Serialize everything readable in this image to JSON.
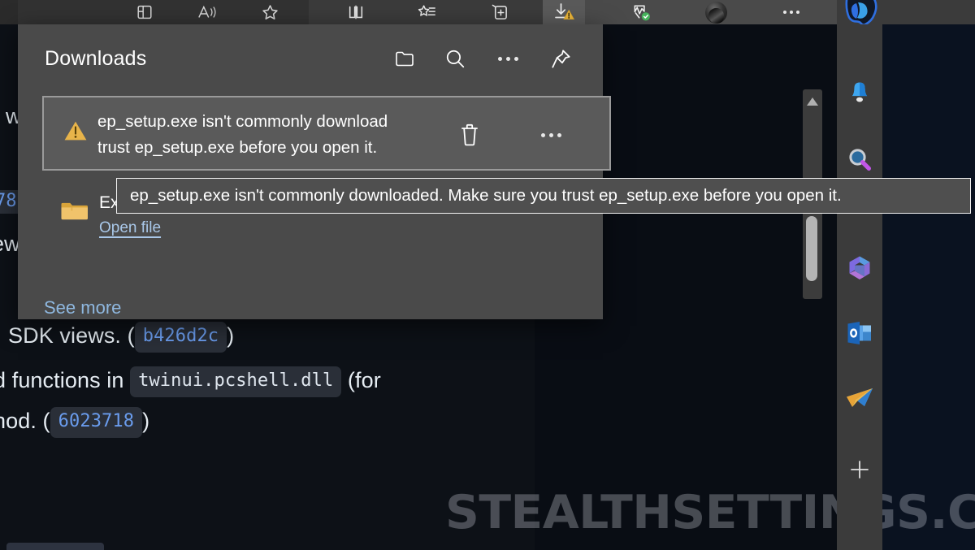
{
  "toolbar": {
    "buttons": [
      {
        "name": "split-screen-icon",
        "label": "Split screen"
      },
      {
        "name": "read-aloud-icon",
        "label": "Read aloud"
      },
      {
        "name": "favorites-star-icon",
        "label": "Favorites"
      },
      {
        "name": "browser-split-icon",
        "label": "Split screen"
      },
      {
        "name": "collections-icon",
        "label": "Collections"
      },
      {
        "name": "add-tab-icon",
        "label": "Add this page to"
      },
      {
        "name": "downloads-icon",
        "label": "Downloads"
      },
      {
        "name": "browser-essentials-icon",
        "label": "Browser essentials"
      },
      {
        "name": "profile-avatar",
        "label": "Profile"
      },
      {
        "name": "settings-more-icon",
        "label": "Settings and more"
      },
      {
        "name": "copilot-icon",
        "label": "Copilot"
      }
    ]
  },
  "downloads": {
    "title": "Downloads",
    "header_buttons": [
      {
        "name": "open-downloads-folder-icon",
        "label": "Open downloads folder"
      },
      {
        "name": "search-downloads-icon",
        "label": "Search downloads"
      },
      {
        "name": "downloads-more-options-icon",
        "label": "More options"
      },
      {
        "name": "keep-downloads-open-icon",
        "label": "Keep Downloads open"
      }
    ],
    "items": [
      {
        "icon": "warning-triangle-icon",
        "line1": "ep_setup.exe isn't commonly download",
        "line2": "trust ep_setup.exe before you open it.",
        "delete_label": "Delete",
        "more_label": "More actions"
      },
      {
        "icon": "folder-icon",
        "name": "Expl",
        "action": "Open file"
      }
    ],
    "see_more": "See more"
  },
  "tooltip": {
    "text": "ep_setup.exe isn't commonly downloaded. Make sure you trust ep_setup.exe before you open it."
  },
  "page_content": {
    "lines": [
      {
        "pre": "SDK views. (",
        "code": "b426d2c",
        "post": ")"
      },
      {
        "pre": "d functions in ",
        "code": "twinui.pcshell.dll",
        "post": " (for"
      },
      {
        "pre": "hod. (",
        "code": "6023718",
        "post": ")"
      }
    ],
    "edge_fragments": [
      {
        "text": "s w"
      },
      {
        "text": "78",
        "code": true
      },
      {
        "text": "ew"
      }
    ],
    "watermark": "STEALTHSETTINGS.COM"
  },
  "sidebar": {
    "items": [
      {
        "name": "notifications-bell-icon",
        "label": "Notifications"
      },
      {
        "name": "search-magnifier-icon",
        "label": "Search"
      },
      {
        "name": "microsoft-365-icon",
        "label": "Microsoft 365"
      },
      {
        "name": "outlook-icon",
        "label": "Outlook"
      },
      {
        "name": "telegram-icon",
        "label": "Telegram"
      },
      {
        "name": "add-sidebar-app-icon",
        "label": "Customize"
      }
    ]
  },
  "scrollbar": {
    "up_arrow": "scroll-up-arrow-icon"
  },
  "colors": {
    "panel_bg": "#4a4a4a",
    "item_selected_bg": "#5a5a5a",
    "tooltip_bg": "#4f4f4f",
    "warning_amber": "#e8b44a",
    "link_blue": "#8fb8e0",
    "code_blue": "#6a9ced",
    "page_bg": "#0d1117"
  }
}
